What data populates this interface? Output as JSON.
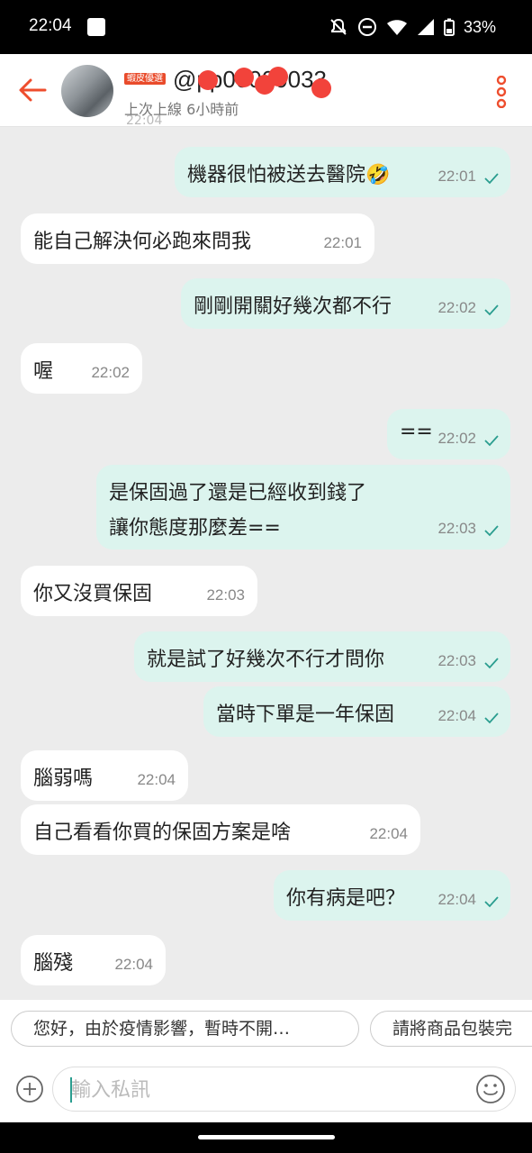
{
  "status_bar": {
    "time": "22:04",
    "battery": "33%"
  },
  "header": {
    "badge": "蝦皮優選",
    "username": "@pp00000033",
    "last_seen": "上次上線 6小時前"
  },
  "cut_timestamp": "22:04",
  "messages": [
    {
      "dir": "out",
      "text": "機器很怕被送去醫院🤣",
      "time": "22:01"
    },
    {
      "dir": "in",
      "text": "能自己解決何必跑來問我",
      "time": "22:01"
    },
    {
      "dir": "out",
      "text": "剛剛開關好幾次都不行",
      "time": "22:02"
    },
    {
      "dir": "in",
      "text": "喔",
      "time": "22:02"
    },
    {
      "dir": "out",
      "text": "==",
      "time": "22:02"
    },
    {
      "dir": "out",
      "text_line1": "是保固過了還是已經收到錢了",
      "text_line2": "讓你態度那麼差==",
      "time": "22:03"
    },
    {
      "dir": "in",
      "text": "你又沒買保固",
      "time": "22:03"
    },
    {
      "dir": "out",
      "text": "就是試了好幾次不行才問你",
      "time": "22:03"
    },
    {
      "dir": "out",
      "text": "當時下單是一年保固",
      "time": "22:04"
    },
    {
      "dir": "in",
      "text": "腦弱嗎",
      "time": "22:04"
    },
    {
      "dir": "in",
      "text": "自己看看你買的保固方案是啥",
      "time": "22:04"
    },
    {
      "dir": "out",
      "text": "你有病是吧？",
      "time": "22:04"
    },
    {
      "dir": "in",
      "text": "腦殘",
      "time": "22:04"
    }
  ],
  "quick_replies": [
    "您好，由於疫情影響，暫時不開…",
    "請將商品包裝完"
  ],
  "input": {
    "placeholder": "輸入私訊"
  },
  "colors": {
    "brand": "#ee4d2d",
    "outgoing_bubble": "#dcf4ee",
    "incoming_bubble": "#ffffff",
    "check": "#2a9d8f"
  },
  "icons": [
    "back-arrow-icon",
    "more-vertical-icon",
    "read-check-icon",
    "add-icon",
    "emoji-icon"
  ]
}
